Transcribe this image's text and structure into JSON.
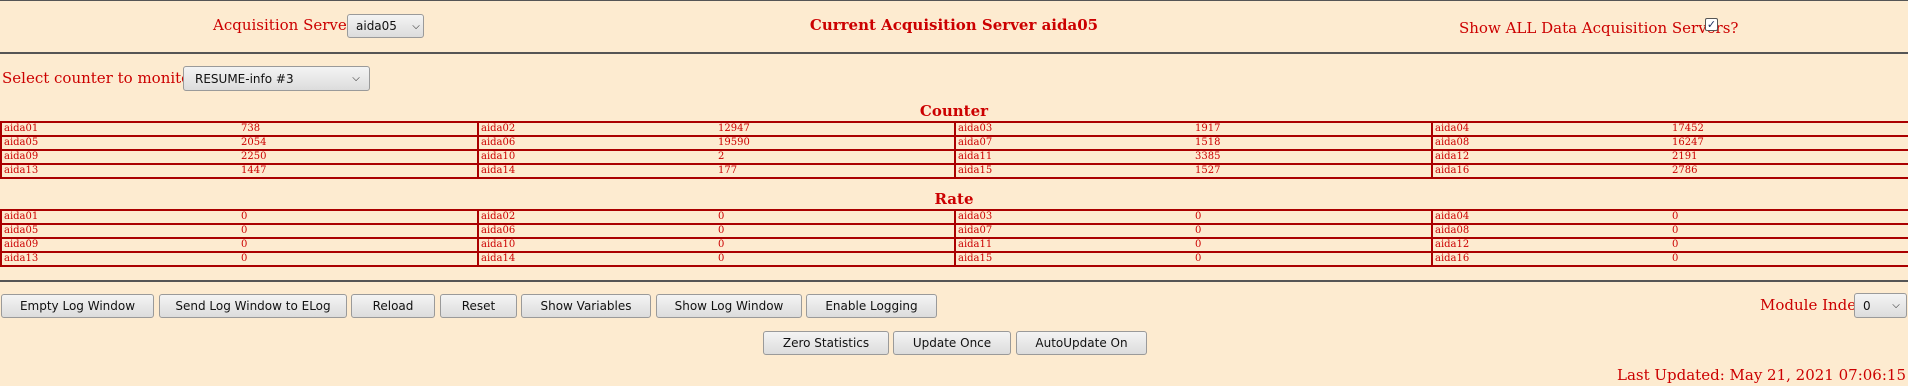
{
  "header": {
    "servers_label": "Acquisition Servers",
    "servers_selected": "aida05",
    "current_server": "Current Acquisition Server aida05",
    "show_all_label": "Show ALL Data Acquisition Servers?",
    "show_all_checked": true
  },
  "monitor": {
    "label": "Select counter to monitor",
    "selected": "RESUME-info #3"
  },
  "counter": {
    "title": "Counter",
    "rows": [
      [
        [
          "aida01",
          "738"
        ],
        [
          "aida02",
          "12947"
        ],
        [
          "aida03",
          "1917"
        ],
        [
          "aida04",
          "17452"
        ]
      ],
      [
        [
          "aida05",
          "2054"
        ],
        [
          "aida06",
          "19590"
        ],
        [
          "aida07",
          "1518"
        ],
        [
          "aida08",
          "16247"
        ]
      ],
      [
        [
          "aida09",
          "2250"
        ],
        [
          "aida10",
          "2"
        ],
        [
          "aida11",
          "3385"
        ],
        [
          "aida12",
          "2191"
        ]
      ],
      [
        [
          "aida13",
          "1447"
        ],
        [
          "aida14",
          "177"
        ],
        [
          "aida15",
          "1527"
        ],
        [
          "aida16",
          "2786"
        ]
      ]
    ]
  },
  "rate": {
    "title": "Rate",
    "rows": [
      [
        [
          "aida01",
          "0"
        ],
        [
          "aida02",
          "0"
        ],
        [
          "aida03",
          "0"
        ],
        [
          "aida04",
          "0"
        ]
      ],
      [
        [
          "aida05",
          "0"
        ],
        [
          "aida06",
          "0"
        ],
        [
          "aida07",
          "0"
        ],
        [
          "aida08",
          "0"
        ]
      ],
      [
        [
          "aida09",
          "0"
        ],
        [
          "aida10",
          "0"
        ],
        [
          "aida11",
          "0"
        ],
        [
          "aida12",
          "0"
        ]
      ],
      [
        [
          "aida13",
          "0"
        ],
        [
          "aida14",
          "0"
        ],
        [
          "aida15",
          "0"
        ],
        [
          "aida16",
          "0"
        ]
      ]
    ]
  },
  "buttons": {
    "empty_log": "Empty Log Window",
    "send_log": "Send Log Window to ELog",
    "reload": "Reload",
    "reset": "Reset",
    "show_variables": "Show Variables",
    "show_log": "Show Log Window",
    "enable_logging": "Enable Logging",
    "zero_stats": "Zero Statistics",
    "update_once": "Update Once",
    "autoupdate": "AutoUpdate On"
  },
  "module_index": {
    "label": "Module Index",
    "value": "0"
  },
  "last_updated": "Last Updated: May 21, 2021 07:06:15"
}
